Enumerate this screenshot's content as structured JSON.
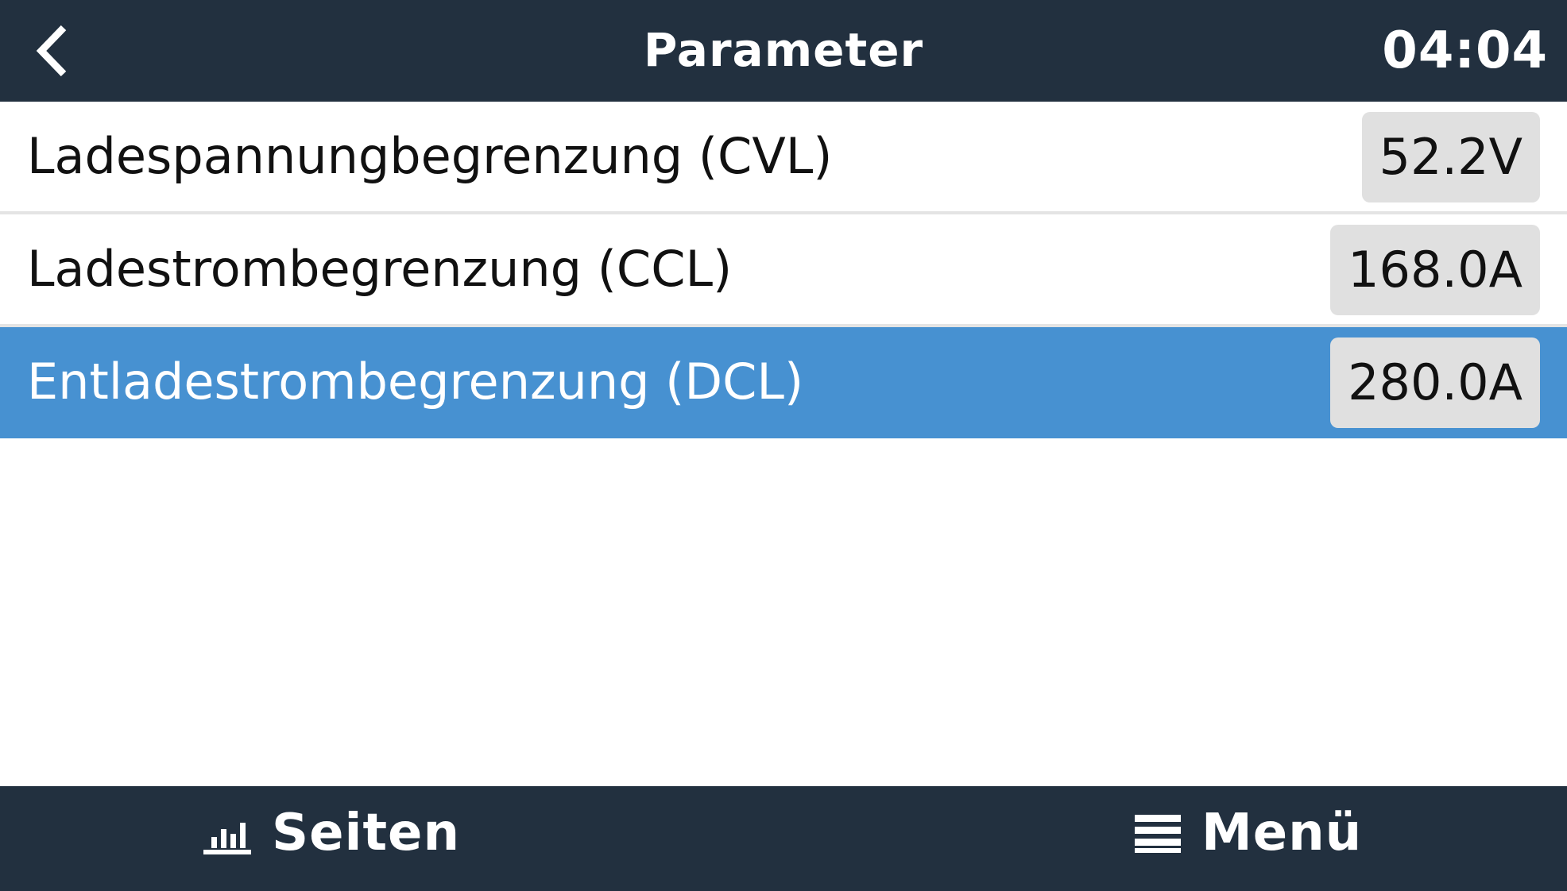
{
  "header": {
    "back_icon": "chevron-left-icon",
    "title": "Parameter",
    "clock": "04:04"
  },
  "rows": [
    {
      "label": "Ladespannungbegrenzung (CVL)",
      "value": "52.2V",
      "selected": false
    },
    {
      "label": "Ladestrombegrenzung (CCL)",
      "value": "168.0A",
      "selected": false
    },
    {
      "label": "Entladestrombegrenzung (DCL)",
      "value": "280.0A",
      "selected": true
    }
  ],
  "footer": {
    "pages_icon": "bar-chart-icon",
    "pages_label": "Seiten",
    "menu_icon": "hamburger-menu-icon",
    "menu_label": "Menü"
  },
  "colors": {
    "bar_background": "#22303f",
    "selected_row": "#4791d1",
    "value_box": "#e0e0e0"
  }
}
